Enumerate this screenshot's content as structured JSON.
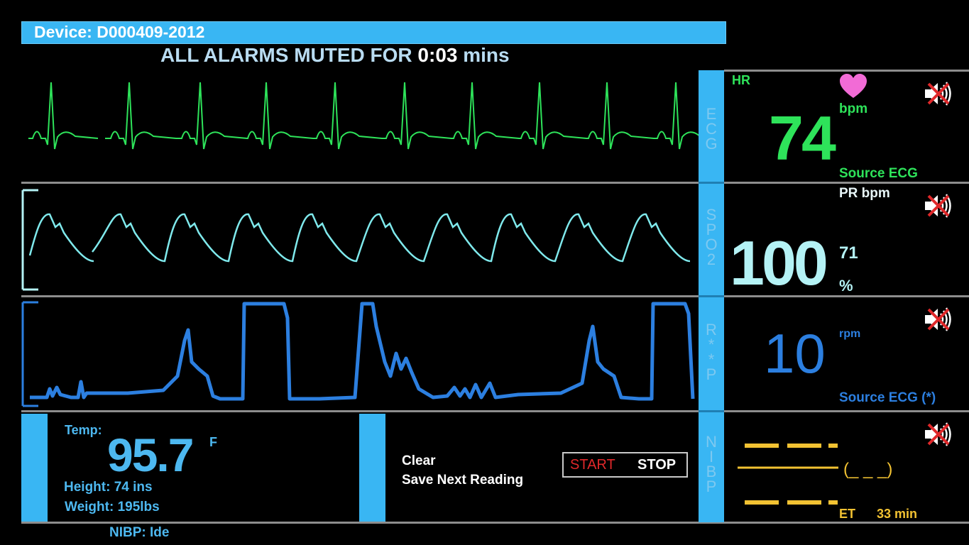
{
  "header": {
    "device_label": "Device: D000409-2012",
    "alarm_prefix": "ALL ALARMS MUTED FOR",
    "alarm_time": "0:03",
    "alarm_unit": "mins"
  },
  "channels": {
    "ecg": {
      "tab_label": "ECG",
      "title": "HR",
      "unit": "bpm",
      "value": "74",
      "source": "Source ECG",
      "color": "#2ee35a"
    },
    "spo2": {
      "tab_label": "SPO2",
      "pr_label": "PR bpm",
      "value": "100",
      "pr_value": "71",
      "unit": "%",
      "color": "#b4f2f5"
    },
    "resp": {
      "tab_label": "R**P",
      "value": "10",
      "unit": "rpm",
      "source": "Source ECG (*)",
      "color": "#2c7fe0"
    },
    "nibp": {
      "tab_label": "NIBP",
      "mean_display": "(_ _ _)",
      "et_label": "ET",
      "et_value": "33 min",
      "color": "#f2c232"
    }
  },
  "bottom": {
    "temp_label": "Temp:",
    "temp_value": "95.7",
    "temp_unit": "F",
    "height": "Height: 74 ins",
    "weight": "Weight: 195lbs",
    "nibp_status": "NIBP: Ide",
    "clear_label": "Clear",
    "save_label": "Save Next Reading",
    "start_label": "START",
    "stop_label": "STOP"
  },
  "colors": {
    "accent": "#39b6f3",
    "heart": "#f26bd6",
    "mute_red": "#e0282a"
  },
  "icons": [
    "heart-icon",
    "speaker-muted-icon"
  ]
}
